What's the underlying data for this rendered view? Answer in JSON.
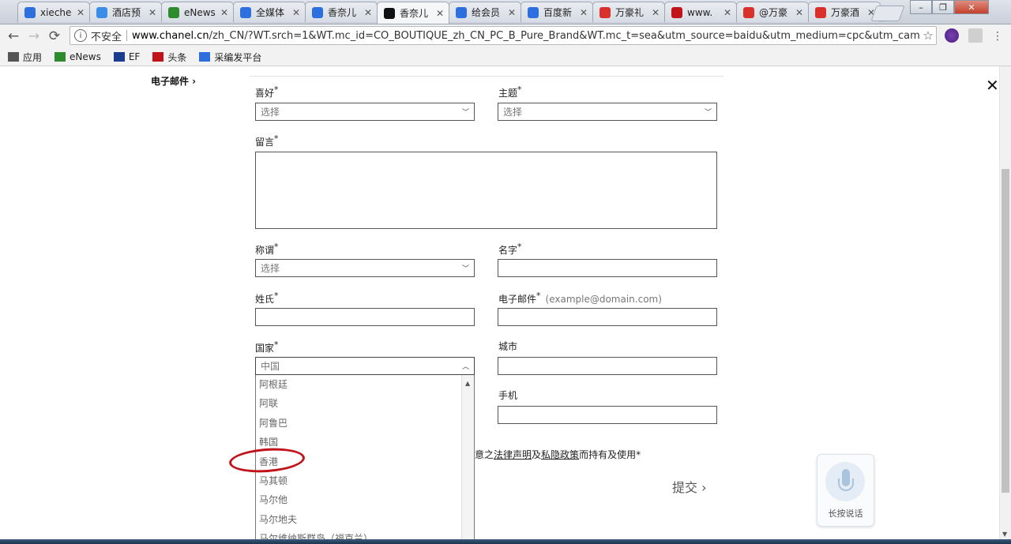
{
  "tabs": [
    {
      "label": "xieche",
      "fav_color": "#2e6fe0",
      "icon": "paw-icon"
    },
    {
      "label": "酒店预",
      "fav_color": "#3a8ee8",
      "icon": "globe-icon"
    },
    {
      "label": "eNews",
      "fav_color": "#2e8b2e",
      "icon": "alien-icon"
    },
    {
      "label": "全媒体",
      "fav_color": "#2e6fe0",
      "icon": "person-icon"
    },
    {
      "label": "香奈儿",
      "fav_color": "#2e6fe0",
      "icon": "paw-icon"
    },
    {
      "label": "香奈儿",
      "fav_color": "#111111",
      "icon": "chanel-icon",
      "active": true
    },
    {
      "label": "给会员",
      "fav_color": "#2e6fe0",
      "icon": "paw-icon"
    },
    {
      "label": "百度新",
      "fav_color": "#2e6fe0",
      "icon": "paw-icon"
    },
    {
      "label": "万豪礼",
      "fav_color": "#d9302c",
      "icon": "weibo-icon"
    },
    {
      "label": "www.",
      "fav_color": "#c0141a",
      "icon": "brand-icon"
    },
    {
      "label": "@万豪",
      "fav_color": "#d9302c",
      "icon": "weibo-icon"
    },
    {
      "label": "万豪酒",
      "fav_color": "#d9302c",
      "icon": "weibo-icon"
    }
  ],
  "toolbar": {
    "insecure_label": "不安全",
    "url_host": "www.chanel.cn",
    "url_rest": "/zh_CN/?WT.srch=1&WT.mc_id=CO_BOUTIQUE_zh_CN_PC_B_Pure_Brand&WT.mc_t=sea&utm_source=baidu&utm_medium=cpc&utm_cam..."
  },
  "bookmarks": [
    {
      "label": "应用",
      "icon": "apps-grid-icon"
    },
    {
      "label": "eNews",
      "icon": "alien-icon"
    },
    {
      "label": "EF",
      "icon": "ef-logo-icon"
    },
    {
      "label": "头条",
      "icon": "toutiao-icon"
    },
    {
      "label": "采编发平台",
      "icon": "globe-person-icon"
    }
  ],
  "sidenav": {
    "email_label": "电子邮件 ›"
  },
  "form": {
    "hobby_label": "喜好",
    "hobby_placeholder": "选择",
    "topic_label": "主题",
    "topic_placeholder": "选择",
    "message_label": "留言",
    "salutation_label": "称谓",
    "salutation_placeholder": "选择",
    "firstname_label": "名字",
    "lastname_label": "姓氏",
    "email_label": "电子邮件",
    "email_hint": "(example@domain.com)",
    "country_label": "国家",
    "country_value": "中国",
    "city_label": "城市",
    "mobile_label": "手机",
    "required_mark": "*",
    "legal_prefix": "意之",
    "legal_link1": "法律声明",
    "legal_mid": "及",
    "legal_link2": "私隐政策",
    "legal_suffix": "而持有及使用*",
    "submit_label": "提交 ›"
  },
  "country_options": [
    "阿根廷",
    "阿联",
    "阿鲁巴",
    "韩国",
    "香港",
    "马其顿",
    "马尔他",
    "马尔地夫",
    "马尔维纳斯群岛（福克兰）"
  ],
  "voice": {
    "label": "长按说话"
  },
  "accent_red": "#c0141a"
}
